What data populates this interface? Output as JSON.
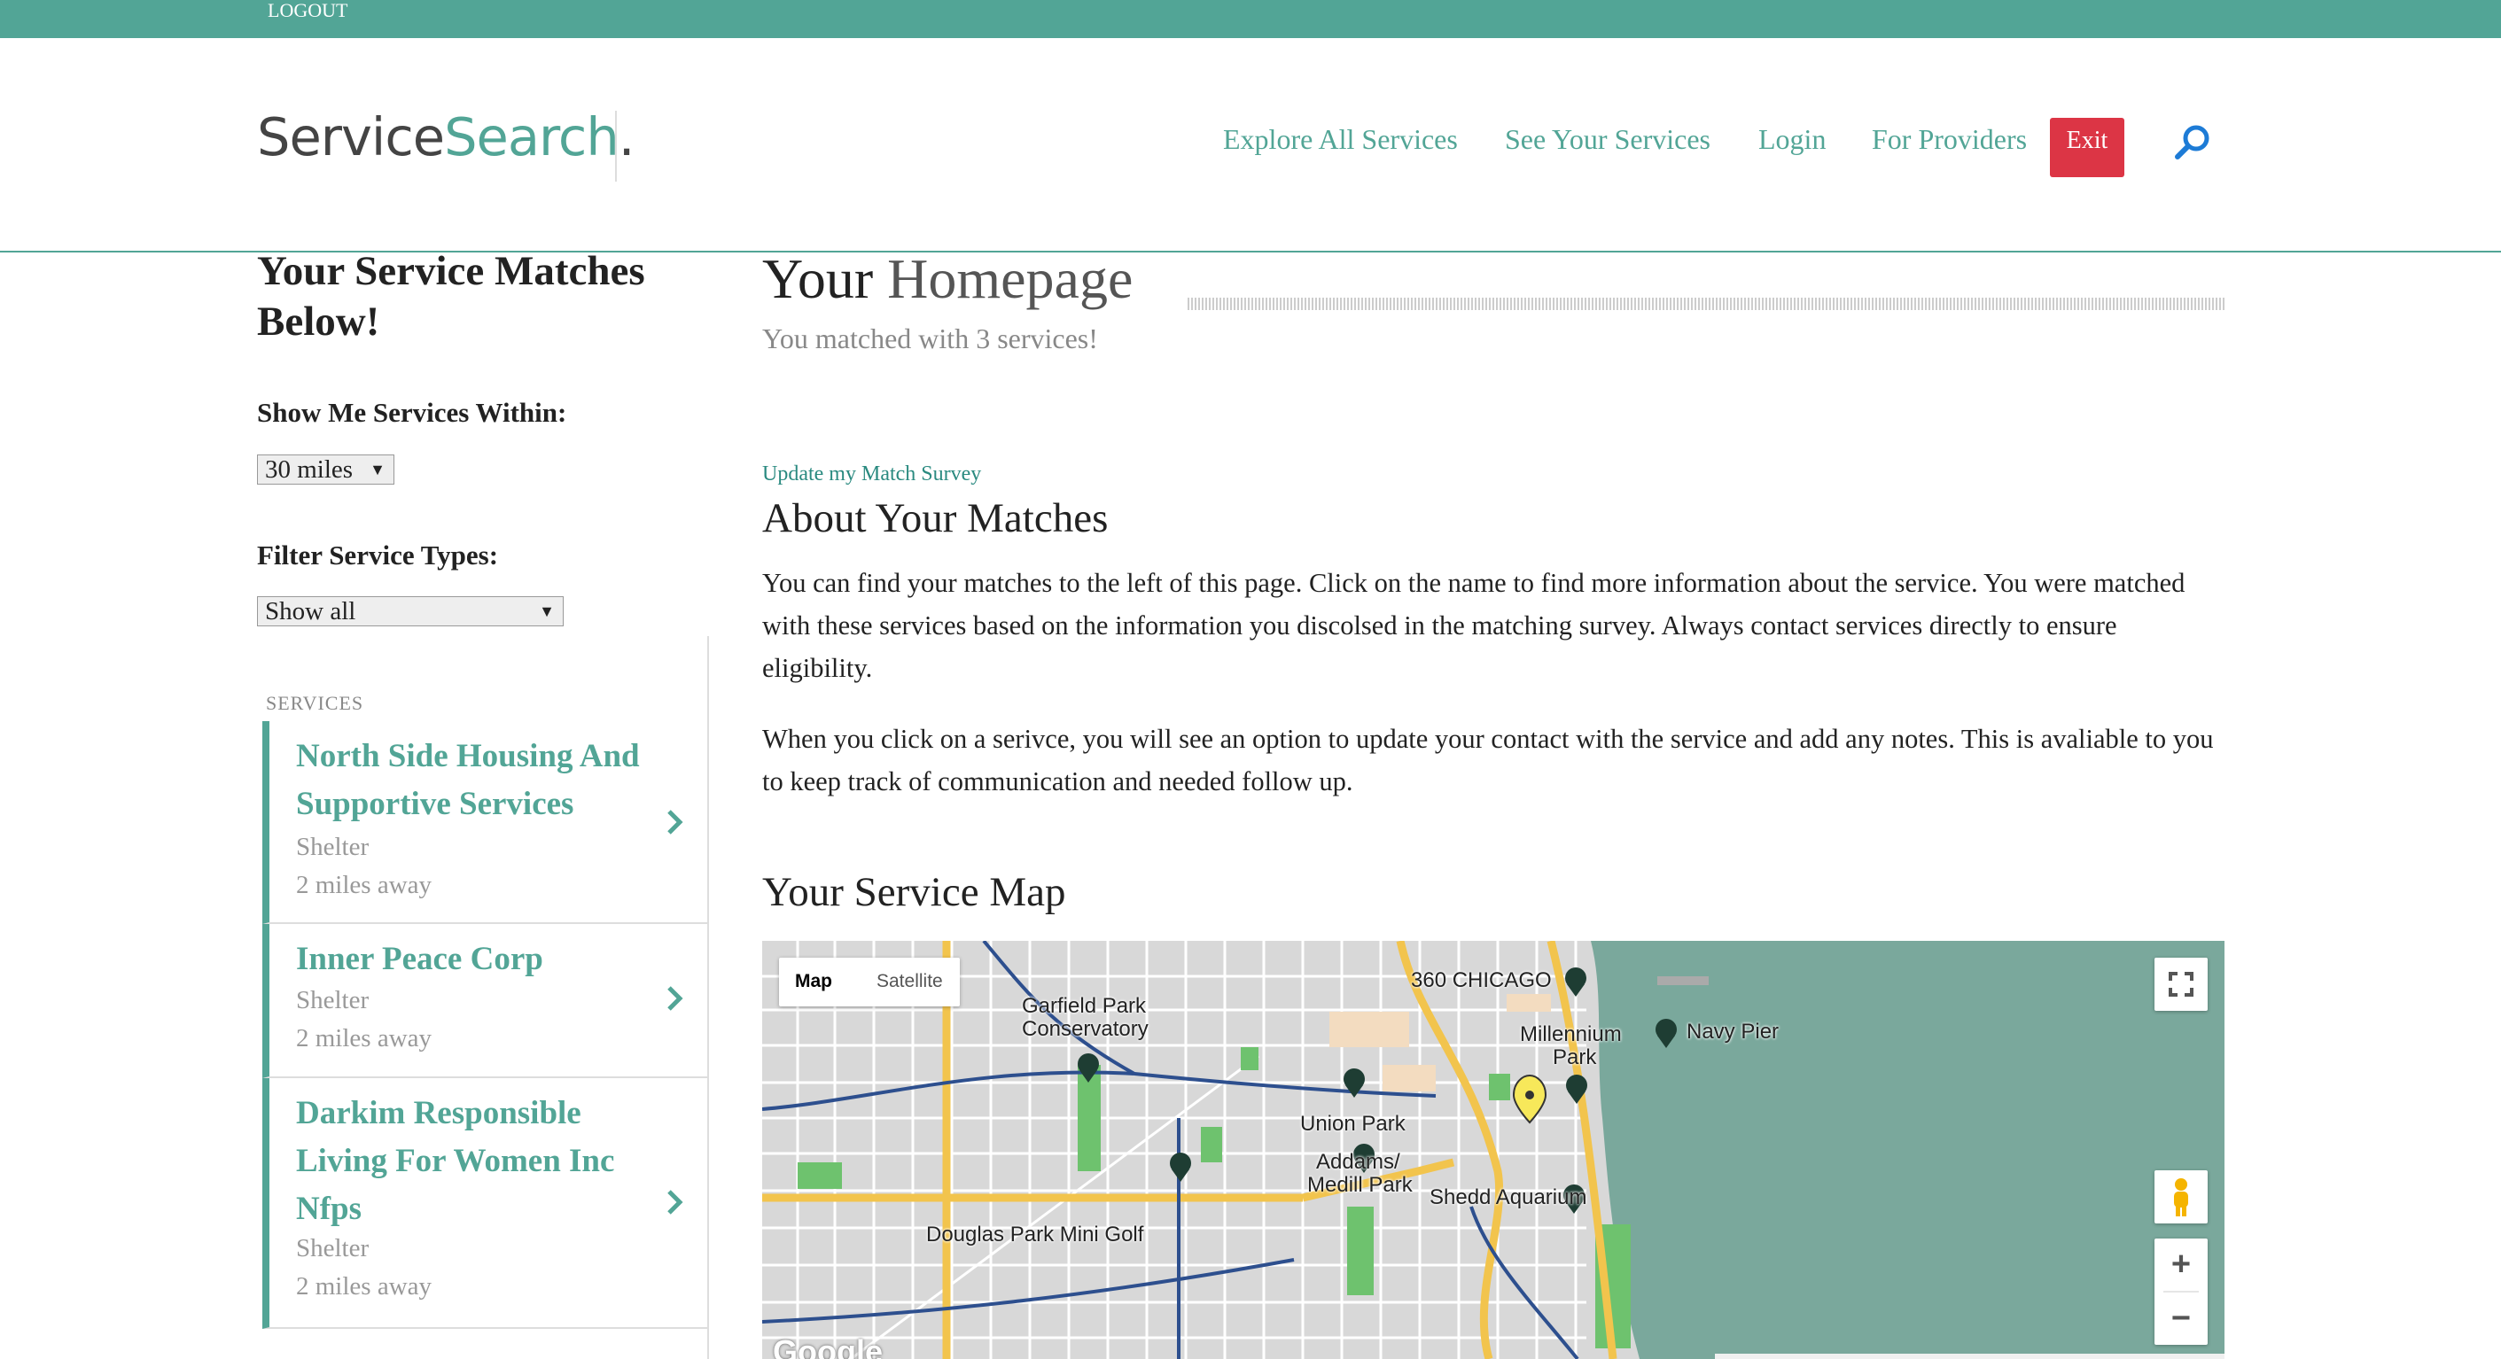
{
  "topbar": {
    "logout": "LOGOUT"
  },
  "header": {
    "logo_part1": "Service",
    "logo_part2": "Search",
    "logo_dot": ".",
    "nav": [
      "Explore All Services",
      "See Your Services",
      "Login",
      "For Providers"
    ],
    "exit_label": "Exit"
  },
  "sidebar": {
    "title": "Your Service Matches Below!",
    "distance_label": "Show Me Services Within:",
    "distance_value": "30 miles",
    "filter_label": "Filter Service Types:",
    "filter_value": "Show all",
    "services_heading": "SERVICES",
    "services": [
      {
        "name": "North Side Housing And Supportive Services",
        "type": "Shelter",
        "distance": "2 miles away"
      },
      {
        "name": "Inner Peace Corp",
        "type": "Shelter",
        "distance": "2 miles away"
      },
      {
        "name": "Darkim Responsible Living For Women Inc Nfps",
        "type": "Shelter",
        "distance": "2 miles away"
      }
    ]
  },
  "main": {
    "title_part1": "Your",
    "title_part2": "Homepage",
    "subtitle": "You matched with 3 services!",
    "update_link": "Update my Match Survey",
    "about_heading": "About Your Matches",
    "about_p1": "You can find your matches to the left of this page. Click on the name to find more information about the service. You were matched with these services based on the information you discolsed in the matching survey. Always contact services directly to ensure eligibility.",
    "about_p2": "When you click on a serivce, you will see an option to update your contact with the service and add any notes. This is avaliable to you to keep track of communication and needed follow up.",
    "map_heading": "Your Service Map"
  },
  "map": {
    "type_map": "Map",
    "type_satellite": "Satellite",
    "zoom_in": "+",
    "zoom_out": "−",
    "google": "Google",
    "labels": {
      "chicago360": "360 CHICAGO",
      "garfield1": "Garfield Park",
      "garfield2": "Conservatory",
      "millennium1": "Millennium",
      "millennium2": "Park",
      "navypier": "Navy Pier",
      "unionpark": "Union Park",
      "addams1": "Addams/",
      "addams2": "Medill Park",
      "shedd": "Shedd Aquarium",
      "douglas": "Douglas Park Mini Golf"
    }
  },
  "colors": {
    "accent": "#52a596",
    "exit": "#dc3545",
    "water": "#7aa89c",
    "park": "#6ec26e",
    "highway": "#f2c44d"
  }
}
